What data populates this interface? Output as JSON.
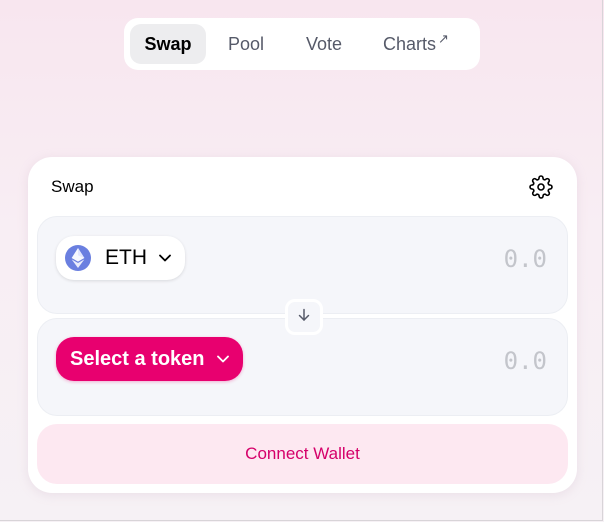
{
  "nav": {
    "items": [
      {
        "label": "Swap",
        "active": true
      },
      {
        "label": "Pool",
        "active": false
      },
      {
        "label": "Vote",
        "active": false
      },
      {
        "label": "Charts",
        "active": false,
        "external_icon": "arrow-up-right-icon",
        "external_glyph": "↗"
      }
    ]
  },
  "swap": {
    "title": "Swap",
    "settings_icon": "gear-icon",
    "input": {
      "token_icon": "eth-logo-icon",
      "token_symbol": "ETH",
      "placeholder": "0.0",
      "value": ""
    },
    "switch_icon": "arrow-down-icon",
    "output": {
      "select_label": "Select a token",
      "placeholder": "0.0",
      "value": ""
    },
    "connect_label": "Connect Wallet"
  },
  "colors": {
    "accent": "#e8006f",
    "accent_text": "#d5006a",
    "connect_bg": "#fde8f1",
    "panel_bg": "#f5f6fa",
    "eth_logo": "#6a7fe0"
  }
}
